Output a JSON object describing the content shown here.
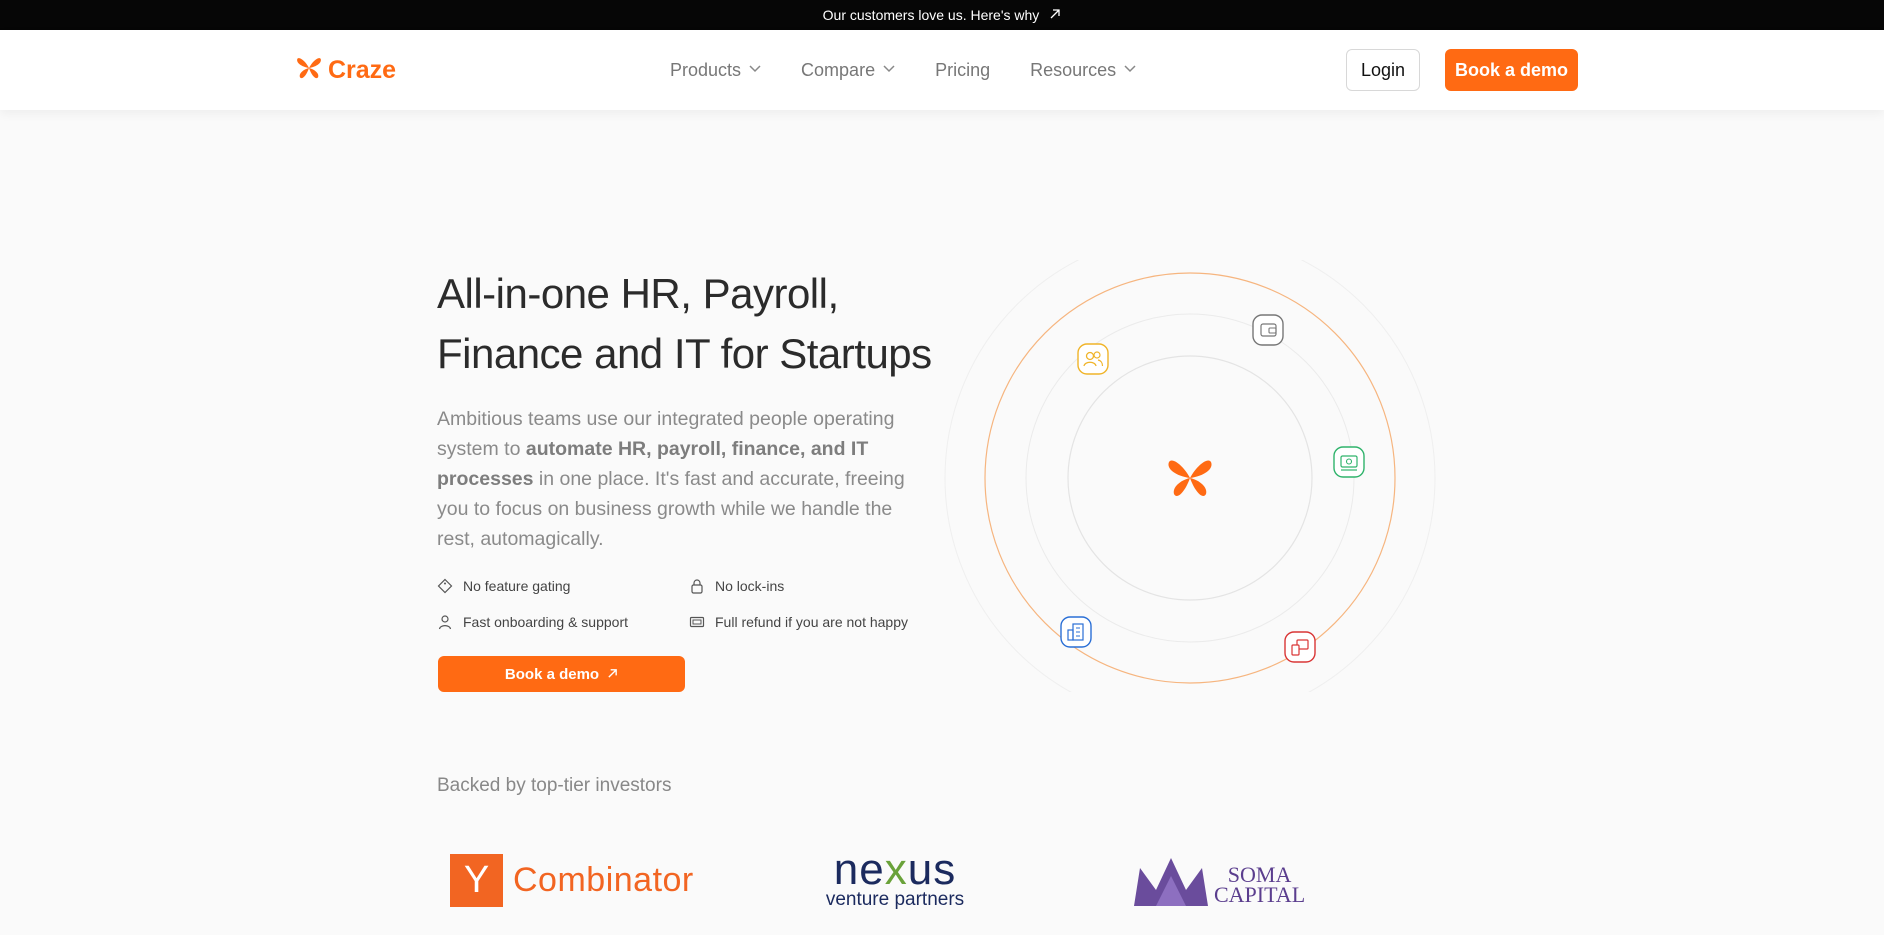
{
  "announcement": {
    "text": "Our customers love us. Here's why",
    "icon": "arrow-up-right-icon"
  },
  "brand": {
    "name": "Craze",
    "accent": "#ff6a13"
  },
  "nav": {
    "items": [
      {
        "label": "Products",
        "has_dropdown": true
      },
      {
        "label": "Compare",
        "has_dropdown": true
      },
      {
        "label": "Pricing",
        "has_dropdown": false
      },
      {
        "label": "Resources",
        "has_dropdown": true
      }
    ],
    "login_label": "Login",
    "demo_label": "Book a demo"
  },
  "hero": {
    "title_line1": "All-in-one HR, Payroll,",
    "title_line2": "Finance and IT for Startups",
    "desc_before": "Ambitious teams use our integrated people operating system to ",
    "desc_bold": "automate HR, payroll, finance, and IT processes",
    "desc_after": " in one place. It's fast and accurate, freeing you to focus on business growth while we handle the rest, automagically.",
    "features": [
      {
        "label": "No feature gating",
        "icon": "tag-icon"
      },
      {
        "label": "No lock-ins",
        "icon": "lock-icon"
      },
      {
        "label": "Fast onboarding & support",
        "icon": "user-icon"
      },
      {
        "label": "Full refund if you are not happy",
        "icon": "money-icon"
      }
    ],
    "cta_label": "Book a demo"
  },
  "orbit": {
    "icons": [
      {
        "name": "users-icon",
        "color": "#f0b429"
      },
      {
        "name": "wallet-icon",
        "color": "#777777"
      },
      {
        "name": "cash-icon",
        "color": "#2fb36b"
      },
      {
        "name": "building-icon",
        "color": "#2a6fd6"
      },
      {
        "name": "devices-icon",
        "color": "#d93636"
      }
    ]
  },
  "investors": {
    "title": "Backed by top-tier investors",
    "yc": {
      "letter": "Y",
      "word": "Combinator"
    },
    "nexus": {
      "word_a": "ne",
      "word_x": "x",
      "word_b": "us",
      "sub": "venture partners"
    },
    "soma": {
      "line1": "SOMA",
      "line2": "CAPITAL"
    }
  }
}
